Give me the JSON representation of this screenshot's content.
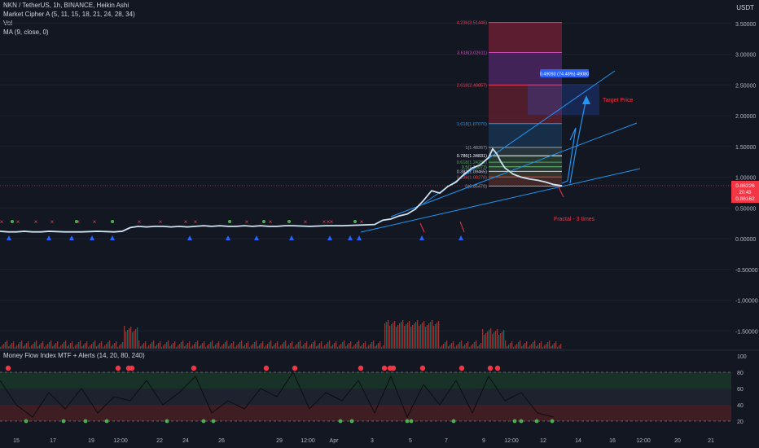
{
  "header": {
    "symbol_line": "NKN / TetherUS, 1h, BINANCE, Heikin Ashi",
    "indicators": [
      "Market Cipher A (5, 11, 15, 18, 21, 24, 28, 34)",
      "Vol",
      "MA (9, close, 0)"
    ],
    "currency": "USDT"
  },
  "lower_pane": {
    "title": "Money Flow Index MTF + Alerts (14, 20, 80, 240)",
    "y_ticks": [
      "100",
      "80",
      "60",
      "40",
      "20"
    ],
    "zones": {
      "overbought": 80,
      "oversold": 20,
      "mid_upper": 60,
      "mid_lower": 40
    }
  },
  "price_labels": {
    "current": "0.86226",
    "sub1": "20:43",
    "sub2": "0.86162"
  },
  "colors": {
    "background": "#131722",
    "price_line": "#cfe3f2",
    "trend": "#2196f3",
    "bull_marker": "#2962ff",
    "bear_marker": "#f23645",
    "green_marker": "#4caf50",
    "fib_red": "#9b2335",
    "fib_purple": "#5b2c6f",
    "fib_blue": "#1f4e79"
  },
  "annotations": {
    "target_label": "Target Price",
    "fractal_label": "Fractal - 3 times",
    "measure_label": "0.49093 (74.48%) 49080"
  },
  "chart_data": {
    "type": "line",
    "title": "NKN / TetherUS, 1h, BINANCE, Heikin Ashi",
    "xlabel": "",
    "ylabel": "",
    "x_ticks": [
      "15",
      "17",
      "19",
      "12:00",
      "22",
      "24",
      "26",
      "29",
      "12:00",
      "Apr",
      "3",
      "5",
      "7",
      "9",
      "12:00",
      "12",
      "14",
      "16",
      "12:00",
      "20",
      "21"
    ],
    "y_ticks": [
      "3.50000",
      "3.00000",
      "2.50000",
      "2.00000",
      "1.50000",
      "1.00000",
      "0.50000",
      "0.00000",
      "-0.50000",
      "-1.00000",
      "-1.50000"
    ],
    "ylim": [
      -1.7,
      3.7
    ],
    "series": [
      {
        "name": "NKN / TetherUS",
        "x": [
          0,
          10,
          20,
          30,
          40,
          50,
          60,
          80,
          100,
          120,
          140,
          150,
          160,
          170,
          180,
          190,
          200,
          210,
          220,
          230,
          240,
          250,
          260,
          270,
          280,
          290,
          300,
          310,
          320,
          330,
          340,
          350,
          360,
          380,
          400,
          420,
          440,
          460,
          470,
          480,
          490,
          500,
          510,
          520,
          530,
          540,
          550,
          560,
          570,
          580,
          590,
          600,
          605,
          610,
          615,
          620,
          625,
          630,
          640,
          650,
          660,
          670,
          680,
          690
        ],
        "values": [
          0.12,
          0.11,
          0.11,
          0.12,
          0.11,
          0.11,
          0.12,
          0.11,
          0.11,
          0.12,
          0.11,
          0.12,
          0.18,
          0.2,
          0.19,
          0.2,
          0.2,
          0.19,
          0.2,
          0.19,
          0.2,
          0.21,
          0.2,
          0.21,
          0.2,
          0.2,
          0.21,
          0.2,
          0.21,
          0.2,
          0.2,
          0.21,
          0.21,
          0.2,
          0.21,
          0.21,
          0.22,
          0.23,
          0.3,
          0.32,
          0.37,
          0.4,
          0.48,
          0.62,
          0.78,
          0.74,
          0.85,
          0.92,
          1.05,
          1.15,
          1.2,
          1.32,
          1.46,
          1.38,
          1.25,
          1.15,
          1.1,
          1.05,
          1.0,
          0.97,
          0.95,
          0.92,
          0.88,
          0.86
        ]
      }
    ],
    "fib_levels": [
      {
        "label": "4.236(3.51446)",
        "value": 3.51446
      },
      {
        "label": "3.618(3.02611)",
        "value": 3.02611
      },
      {
        "label": "2.618(2.49857)",
        "value": 2.49857
      },
      {
        "label": "1.618(1.87070)",
        "value": 1.8707
      },
      {
        "label": "1(1.48267)",
        "value": 1.48267
      },
      {
        "label": "0.786(1.34831)",
        "value": 1.34831
      },
      {
        "label": "0.618(1.24283)",
        "value": 1.24283
      },
      {
        "label": "0.5(1.16873)",
        "value": 1.16873
      },
      {
        "label": "0.382(1.09465)",
        "value": 1.09465
      },
      {
        "label": "0.236(1.00278)",
        "value": 1.00278
      },
      {
        "label": "0(0.85470)",
        "value": 0.8547
      }
    ],
    "mfi": {
      "x": [
        0,
        20,
        40,
        60,
        80,
        100,
        120,
        140,
        160,
        180,
        200,
        220,
        240,
        260,
        280,
        300,
        320,
        340,
        360,
        380,
        400,
        420,
        440,
        460,
        480,
        500,
        520,
        540,
        560,
        580,
        600,
        620,
        640,
        660,
        680
      ],
      "values": [
        70,
        40,
        25,
        55,
        35,
        60,
        30,
        50,
        45,
        70,
        40,
        55,
        75,
        30,
        45,
        35,
        60,
        50,
        80,
        35,
        55,
        45,
        70,
        30,
        75,
        25,
        65,
        40,
        70,
        30,
        75,
        45,
        55,
        30,
        25
      ]
    }
  }
}
